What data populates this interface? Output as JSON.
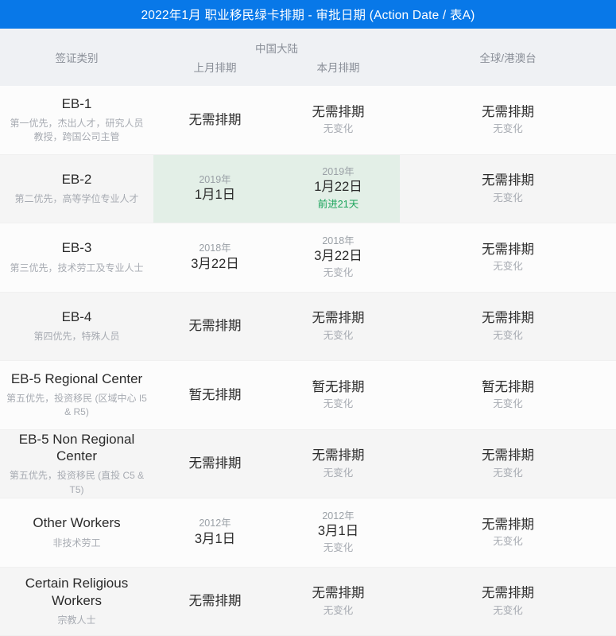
{
  "title": "2022年1月 职业移民绿卡排期 - 审批日期 (Action Date / 表A)",
  "header": {
    "visa_category": "签证类别",
    "china_group": "中国大陆",
    "prev_month": "上月排期",
    "cur_month": "本月排期",
    "global": "全球/港澳台"
  },
  "colors": {
    "title_bar": "#0878e8",
    "header_bg": "#eff1f4",
    "highlight_green": "#e3efe7",
    "advance_text": "#19a35a",
    "row_odd": "#fcfcfc",
    "row_even": "#f5f5f5"
  },
  "rows": [
    {
      "name": "EB-1",
      "desc": "第一优先，杰出人才，研究人员\n教授，跨国公司主管",
      "highlight": false,
      "prev": {
        "year": "",
        "main": "无需排期",
        "note": ""
      },
      "cur": {
        "year": "",
        "main": "无需排期",
        "note": "无变化",
        "note_type": "none"
      },
      "global": {
        "year": "",
        "main": "无需排期",
        "note": "无变化",
        "note_type": "none"
      }
    },
    {
      "name": "EB-2",
      "desc": "第二优先，高等学位专业人才",
      "highlight": true,
      "prev": {
        "year": "2019年",
        "main": "1月1日",
        "note": ""
      },
      "cur": {
        "year": "2019年",
        "main": "1月22日",
        "note": "前进21天",
        "note_type": "advance"
      },
      "global": {
        "year": "",
        "main": "无需排期",
        "note": "无变化",
        "note_type": "none"
      }
    },
    {
      "name": "EB-3",
      "desc": "第三优先，技术劳工及专业人士",
      "highlight": false,
      "prev": {
        "year": "2018年",
        "main": "3月22日",
        "note": ""
      },
      "cur": {
        "year": "2018年",
        "main": "3月22日",
        "note": "无变化",
        "note_type": "none"
      },
      "global": {
        "year": "",
        "main": "无需排期",
        "note": "无变化",
        "note_type": "none"
      }
    },
    {
      "name": "EB-4",
      "desc": "第四优先，特殊人员",
      "highlight": false,
      "prev": {
        "year": "",
        "main": "无需排期",
        "note": ""
      },
      "cur": {
        "year": "",
        "main": "无需排期",
        "note": "无变化",
        "note_type": "none"
      },
      "global": {
        "year": "",
        "main": "无需排期",
        "note": "无变化",
        "note_type": "none"
      }
    },
    {
      "name": "EB-5 Regional Center",
      "desc": "第五优先，投资移民 (区域中心 I5 & R5)",
      "highlight": false,
      "prev": {
        "year": "",
        "main": "暂无排期",
        "note": ""
      },
      "cur": {
        "year": "",
        "main": "暂无排期",
        "note": "无变化",
        "note_type": "none"
      },
      "global": {
        "year": "",
        "main": "暂无排期",
        "note": "无变化",
        "note_type": "none"
      }
    },
    {
      "name": "EB-5 Non Regional Center",
      "desc": "第五优先，投资移民 (直投 C5 & T5)",
      "highlight": false,
      "prev": {
        "year": "",
        "main": "无需排期",
        "note": ""
      },
      "cur": {
        "year": "",
        "main": "无需排期",
        "note": "无变化",
        "note_type": "none"
      },
      "global": {
        "year": "",
        "main": "无需排期",
        "note": "无变化",
        "note_type": "none"
      }
    },
    {
      "name": "Other Workers",
      "desc": "非技术劳工",
      "highlight": false,
      "prev": {
        "year": "2012年",
        "main": "3月1日",
        "note": ""
      },
      "cur": {
        "year": "2012年",
        "main": "3月1日",
        "note": "无变化",
        "note_type": "none"
      },
      "global": {
        "year": "",
        "main": "无需排期",
        "note": "无变化",
        "note_type": "none"
      }
    },
    {
      "name": "Certain Religious Workers",
      "desc": "宗教人士",
      "highlight": false,
      "prev": {
        "year": "",
        "main": "无需排期",
        "note": ""
      },
      "cur": {
        "year": "",
        "main": "无需排期",
        "note": "无变化",
        "note_type": "none"
      },
      "global": {
        "year": "",
        "main": "无需排期",
        "note": "无变化",
        "note_type": "none"
      }
    }
  ]
}
